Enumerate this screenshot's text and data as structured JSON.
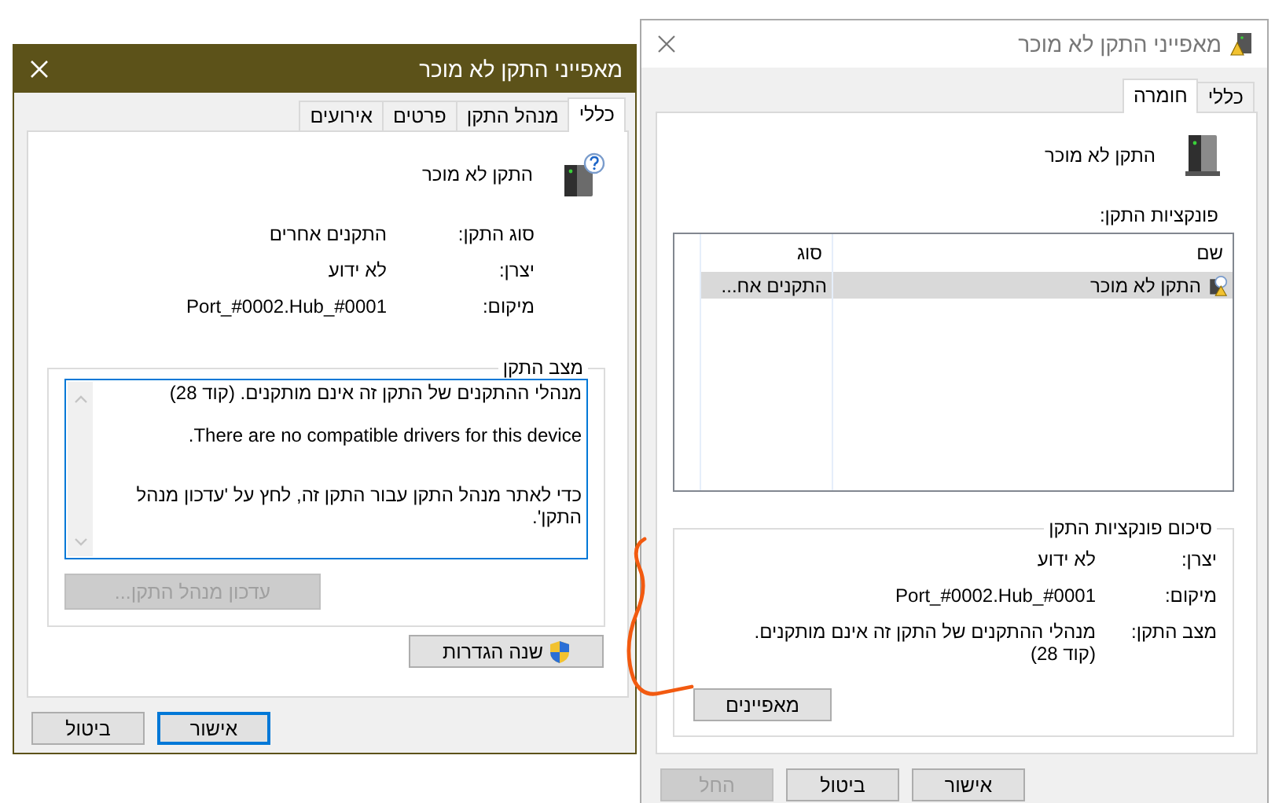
{
  "back_dialog": {
    "title": "מאפייני התקן לא מוכר",
    "active": false,
    "tabs": [
      {
        "label": "כללי",
        "selected": false
      },
      {
        "label": "חומרה",
        "selected": true
      }
    ],
    "device_name": "התקן לא מוכר",
    "functions_label": "פונקציות התקן:",
    "table": {
      "columns": [
        "שם",
        "סוג"
      ],
      "rows": [
        {
          "cells": [
            "התקן לא מוכר",
            "התקנים אח..."
          ],
          "selected": true
        }
      ]
    },
    "summary": {
      "title": "סיכום פונקציות התקן",
      "rows": [
        {
          "label": "יצרן:",
          "value": "לא ידוע"
        },
        {
          "label": "מיקום:",
          "value": "Port_#0002.Hub_#0001"
        },
        {
          "label": "מצב התקן:",
          "value": "מנהלי ההתקנים של התקן זה אינם מותקנים. (קוד 28)"
        }
      ]
    },
    "properties_button": {
      "label": "מאפיינים"
    },
    "buttons": [
      {
        "label": "אישור",
        "default": false,
        "disabled": false
      },
      {
        "label": "ביטול",
        "default": false,
        "disabled": false
      },
      {
        "label": "החל",
        "default": false,
        "disabled": true
      }
    ]
  },
  "front_dialog": {
    "title": "מאפייני התקן לא מוכר",
    "active": true,
    "tabs": [
      {
        "label": "כללי",
        "selected": true
      },
      {
        "label": "מנהל התקן",
        "selected": false
      },
      {
        "label": "פרטים",
        "selected": false
      },
      {
        "label": "אירועים",
        "selected": false
      }
    ],
    "device_name": "התקן לא מוכר",
    "properties": [
      {
        "label": "סוג התקן:",
        "value": "התקנים אחרים"
      },
      {
        "label": "יצרן:",
        "value": "לא ידוע"
      },
      {
        "label": "מיקום:",
        "value": "Port_#0002.Hub_#0001"
      }
    ],
    "status": {
      "title": "מצב התקן",
      "paragraphs": [
        "מנהלי ההתקנים של התקן זה אינם מותקנים. (קוד 28)",
        "There are no compatible drivers for this device.",
        "כדי לאתר מנהל התקן עבור התקן זה, לחץ על 'עדכון מנהל התקן'."
      ]
    },
    "update_driver_button": {
      "label": "עדכון מנהל התקן...",
      "disabled": true
    },
    "change_settings_button": {
      "label": "שנה הגדרות"
    },
    "buttons": [
      {
        "label": "אישור",
        "default": true,
        "disabled": false
      },
      {
        "label": "ביטול",
        "default": false,
        "disabled": false
      }
    ]
  }
}
